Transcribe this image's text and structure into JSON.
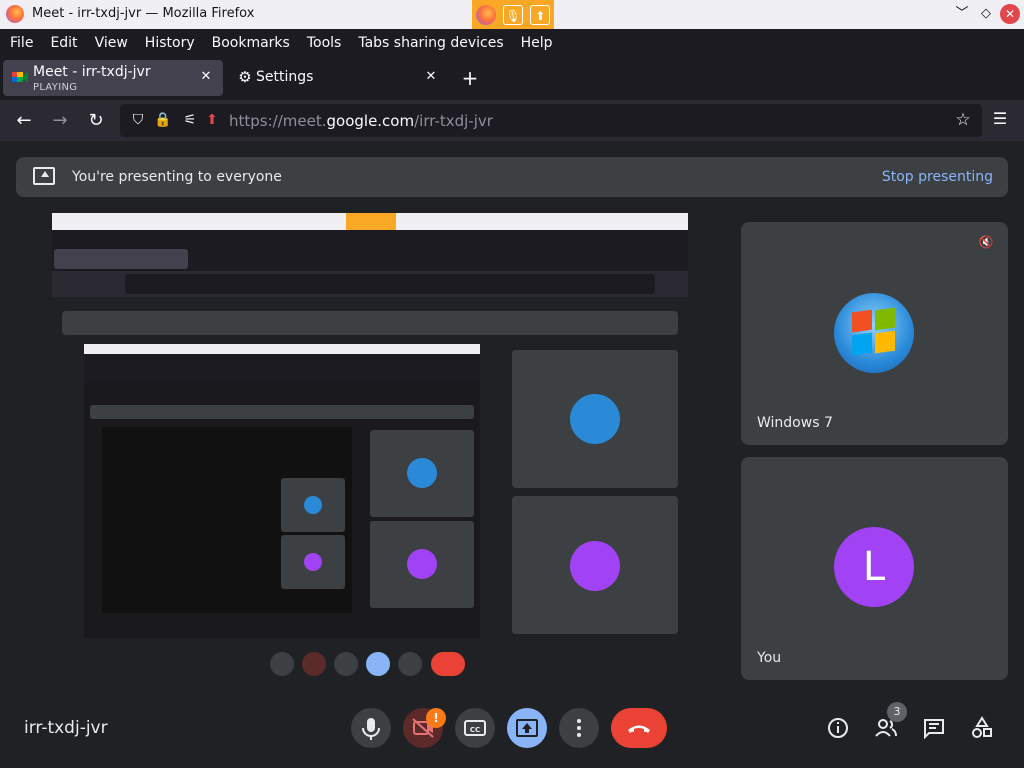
{
  "window": {
    "title": "Meet - irr-txdj-jvr — Mozilla Firefox",
    "controls": {
      "minimize": "﹀",
      "maximize": "◇",
      "close": "✕"
    }
  },
  "menu": [
    {
      "label": "File"
    },
    {
      "label": "Edit"
    },
    {
      "label": "View"
    },
    {
      "label": "History"
    },
    {
      "label": "Bookmarks"
    },
    {
      "label": "Tools"
    },
    {
      "label": "Tabs sharing devices"
    },
    {
      "label": "Help"
    }
  ],
  "tabs": [
    {
      "title": "Meet - irr-txdj-jvr",
      "subtitle": "PLAYING"
    },
    {
      "title": "Settings"
    }
  ],
  "navbar": {
    "url_prefix": "https://meet.",
    "url_host": "google.com",
    "url_path": "/irr-txdj-jvr"
  },
  "banner": {
    "text": "You're presenting to everyone",
    "stop_label": "Stop presenting"
  },
  "participants": [
    {
      "name": "Windows 7",
      "muted": true
    },
    {
      "name": "You",
      "initial": "L",
      "avatar_color": "#a142f4"
    }
  ],
  "meeting_code": "irr-txdj-jvr",
  "controls": {
    "camera_warning": "!",
    "people_count": "3"
  },
  "colors": {
    "accent": "#8ab4f8",
    "end_call": "#ea4335",
    "firefox_indicator": "#f9a825"
  }
}
